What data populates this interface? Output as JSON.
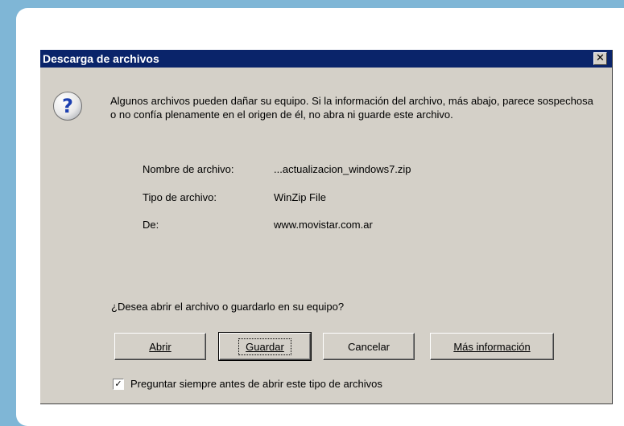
{
  "dialog": {
    "title": "Descarga de archivos",
    "close_glyph": "✕",
    "icon": "question-icon",
    "message": "Algunos archivos pueden dañar su equipo. Si la información del archivo, más abajo, parece sospechosa o no confía plenamente en el origen de él, no abra ni guarde este archivo.",
    "file_name_label": "Nombre de archivo:",
    "file_name_value": "...actualizacion_windows7.zip",
    "file_type_label": "Tipo de archivo:",
    "file_type_value": "WinZip File",
    "from_label": "De:",
    "from_value": "www.movistar.com.ar",
    "question": "¿Desea abrir el archivo o guardarlo en su equipo?",
    "buttons": {
      "open": "Abrir",
      "save": "Guardar",
      "cancel": "Cancelar",
      "more_info": "Más información"
    },
    "checkbox_checked": true,
    "checkbox_label": "Preguntar siempre antes de abrir este tipo de archivos"
  },
  "colors": {
    "titlebar": "#0a246a",
    "dialog_bg": "#d4d0c8",
    "page_bg": "#7fb6d6"
  }
}
